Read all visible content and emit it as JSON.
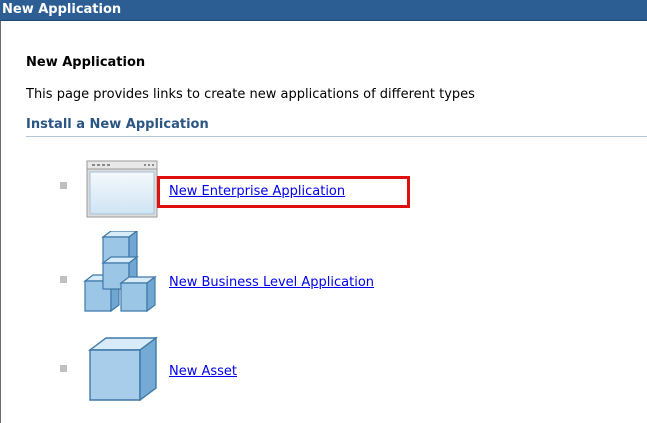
{
  "titlebar": {
    "title": "New Application"
  },
  "content": {
    "heading": "New Application",
    "description": "This page provides links to create new applications of different types",
    "section_title": "Install a New Application",
    "items": [
      {
        "label": "New Enterprise Application",
        "icon": "enterprise-app-window-icon",
        "highlighted": true
      },
      {
        "label": "New Business Level Application",
        "icon": "stacked-cubes-icon",
        "highlighted": false
      },
      {
        "label": "New Asset",
        "icon": "single-cube-icon",
        "highlighted": false
      }
    ]
  },
  "colors": {
    "titlebar_bg": "#2c5e94",
    "section_title": "#2b5583",
    "link": "#0000ee",
    "highlight_border": "#e01010"
  }
}
